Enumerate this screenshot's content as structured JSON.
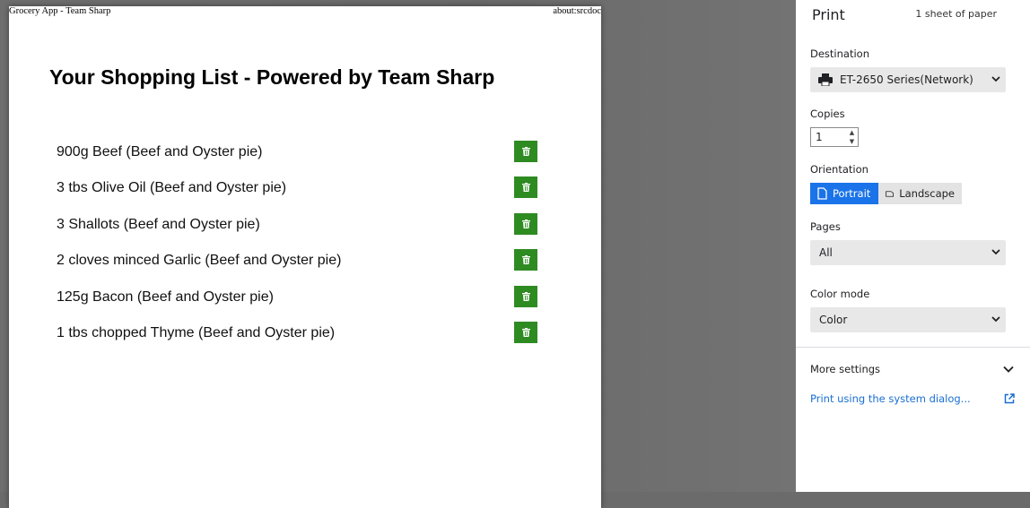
{
  "preview": {
    "header_left": "Grocery App - Team Sharp",
    "header_right": "about:srcdoc",
    "title": "Your Shopping List - Powered by Team Sharp",
    "items": [
      "900g Beef (Beef and Oyster pie)",
      "3 tbs Olive Oil (Beef and Oyster pie)",
      "3 Shallots (Beef and Oyster pie)",
      "2 cloves minced Garlic (Beef and Oyster pie)",
      "125g Bacon (Beef and Oyster pie)",
      "1 tbs chopped Thyme (Beef and Oyster pie)"
    ],
    "delete_icon": "trash-icon",
    "button_color": "#2e8b22"
  },
  "print": {
    "title": "Print",
    "sheet_count": "1 sheet of paper",
    "destination_label": "Destination",
    "destination_value": "ET-2650 Series(Network)",
    "copies_label": "Copies",
    "copies_value": "1",
    "orientation_label": "Orientation",
    "portrait_label": "Portrait",
    "landscape_label": "Landscape",
    "pages_label": "Pages",
    "pages_value": "All",
    "color_mode_label": "Color mode",
    "color_mode_value": "Color",
    "more_settings": "More settings",
    "system_dialog": "Print using the system dialog...",
    "accent_color": "#1a73e8"
  }
}
